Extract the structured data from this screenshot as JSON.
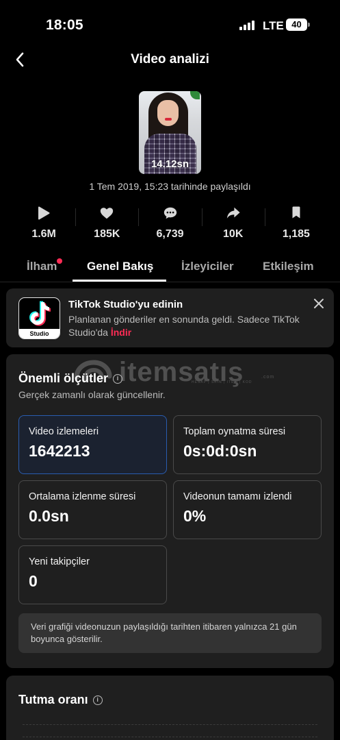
{
  "status_bar": {
    "time": "18:05",
    "network": "LTE",
    "battery": "40"
  },
  "header": {
    "title": "Video analizi"
  },
  "video": {
    "duration": "14.12sn",
    "posted": "1 Tem 2019, 15:23 tarihinde paylaşıldı"
  },
  "stats": [
    {
      "icon": "play-icon",
      "value": "1.6M"
    },
    {
      "icon": "heart-icon",
      "value": "185K"
    },
    {
      "icon": "comment-icon",
      "value": "6,739"
    },
    {
      "icon": "share-icon",
      "value": "10K"
    },
    {
      "icon": "bookmark-icon",
      "value": "1,185"
    }
  ],
  "tabs": [
    {
      "label": "İlham",
      "notification_dot": true
    },
    {
      "label": "Genel Bakış",
      "active": true
    },
    {
      "label": "İzleyiciler"
    },
    {
      "label": "Etkileşim"
    }
  ],
  "promo": {
    "title": "TikTok Studio'yu edinin",
    "text": "Planlanan gönderiler en sonunda geldi. Sadece TikTok Studio'da",
    "link": "İndir",
    "logo_label": "Studio"
  },
  "watermark": {
    "text": "itemsatış",
    "sub": "HESAP | SKIN | ITEM | KOD",
    "suffix": ".com"
  },
  "metrics": {
    "title": "Önemli ölçütler",
    "subtitle": "Gerçek zamanlı olarak güncellenir.",
    "tiles": [
      {
        "label": "Video izlemeleri",
        "value": "1642213",
        "selected": true
      },
      {
        "label": "Toplam oynatma süresi",
        "value": "0s:0d:0sn"
      },
      {
        "label": "Ortalama izlenme süresi",
        "value": "0.0sn"
      },
      {
        "label": "Videonun tamamı izlendi",
        "value": "0%"
      },
      {
        "label": "Yeni takipçiler",
        "value": "0"
      }
    ],
    "note": "Veri grafiği videonuzun paylaşıldığı tarihten itibaren yalnızca 21 gün boyunca gösterilir."
  },
  "retention": {
    "title": "Tutma oranı"
  },
  "colors": {
    "accent": "#fe2c55",
    "selected_border": "#2a5db0",
    "card_bg": "#1f1f1f"
  }
}
